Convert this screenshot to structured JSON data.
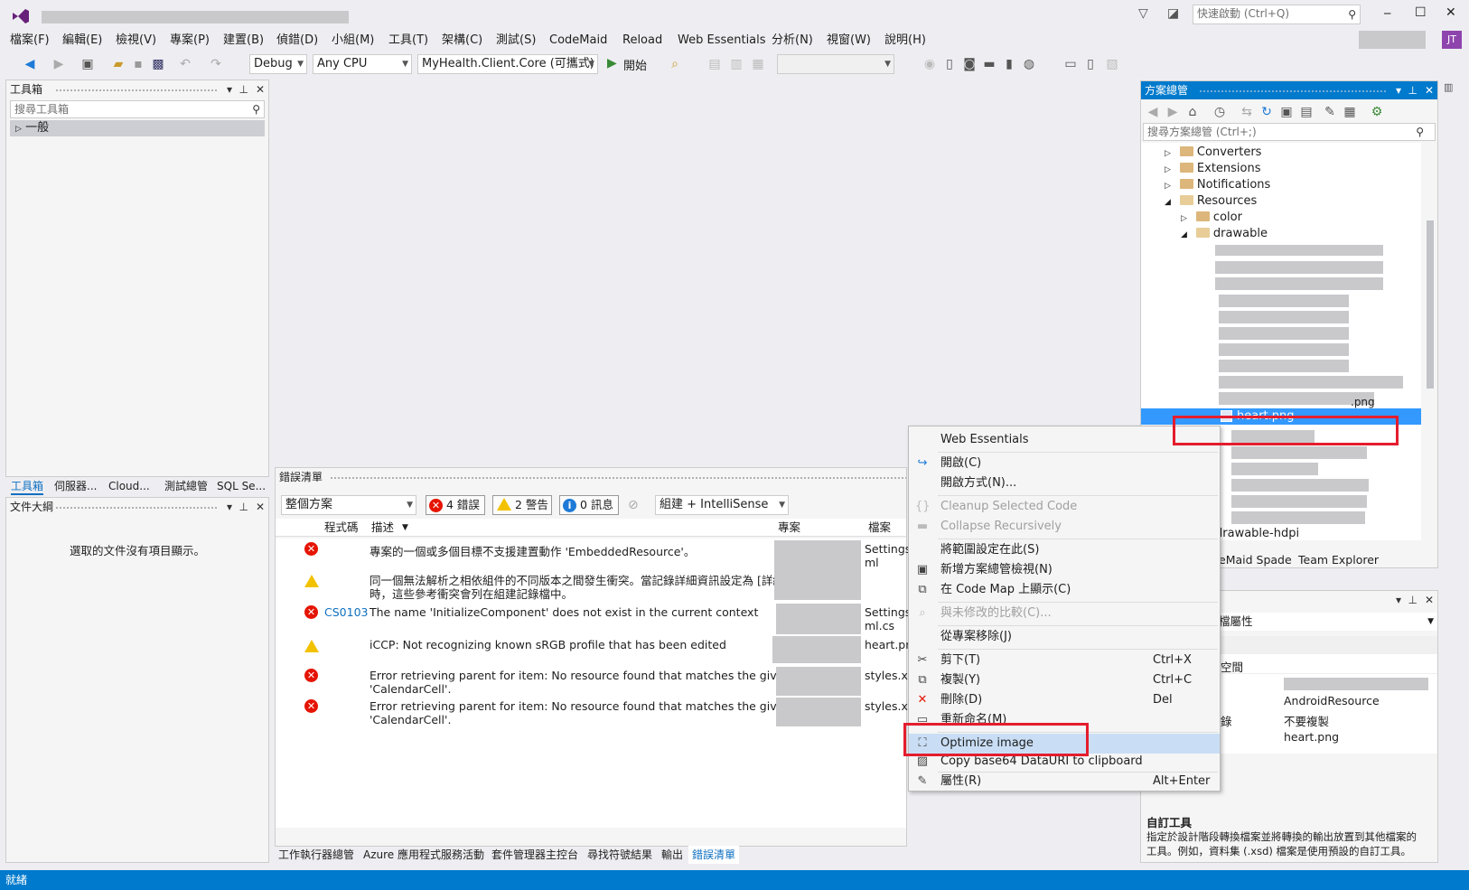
{
  "titlebar": {
    "quick_launch_placeholder": "快速啟動 (Ctrl+Q)",
    "user_initials": "JT",
    "minimize": "─",
    "maximize": "☐",
    "close": "✕"
  },
  "menu": [
    "檔案(F)",
    "編輯(E)",
    "檢視(V)",
    "專案(P)",
    "建置(B)",
    "偵錯(D)",
    "小組(M)",
    "工具(T)",
    "架構(C)",
    "測試(S)",
    "CodeMaid",
    "Reload",
    "Web Essentials",
    "分析(N)",
    "視窗(W)",
    "說明(H)"
  ],
  "toolbar": {
    "config": "Debug",
    "platform": "Any CPU",
    "startup_project": "MyHealth.Client.Core (可攜式)",
    "start_label": "開始"
  },
  "toolbox": {
    "title": "工具箱",
    "search_placeholder": "搜尋工具箱",
    "group": "一般",
    "tabs": [
      "工具箱",
      "伺服器...",
      "Cloud...",
      "測試總管",
      "SQL Se..."
    ]
  },
  "outline": {
    "title": "文件大綱",
    "empty_text": "選取的文件沒有項目顯示。"
  },
  "error_list": {
    "title": "錯誤清單",
    "scope": "整個方案",
    "errors_btn": "4 錯誤",
    "warnings_btn": "2 警告",
    "messages_btn": "0 訊息",
    "build_filter": "組建 + IntelliSense",
    "col_code": "程式碼",
    "col_desc": "描述",
    "col_project": "專案",
    "col_file": "檔案",
    "rows": [
      {
        "type": "error",
        "code": "",
        "desc1": "專案的一個或多個目標不支援建置動作 'EmbeddedResource'。",
        "desc2": "",
        "file1": "Settings",
        "file2": "ml"
      },
      {
        "type": "warning",
        "code": "",
        "desc1": "同一個無法解析之相依組件的不同版本之間發生衝突。當記錄詳細資訊設定為 [詳細]",
        "desc2": "時，這些參考衝突會列在組建記錄檔中。",
        "file1": "",
        "file2": ""
      },
      {
        "type": "error",
        "code": "CS0103",
        "desc1": "The name 'InitializeComponent' does not exist in the current context",
        "desc2": "",
        "file1": "Settings",
        "file2": "ml.cs"
      },
      {
        "type": "warning",
        "code": "",
        "desc1": "iCCP: Not recognizing known sRGB profile that has been edited",
        "desc2": "",
        "file1": "heart.pn",
        "file2": ""
      },
      {
        "type": "error",
        "code": "",
        "desc1": "Error retrieving parent for item: No resource found that matches the given name",
        "desc2": "'CalendarCell'.",
        "file1": "styles.xm",
        "file2": ""
      },
      {
        "type": "error",
        "code": "",
        "desc1": "Error retrieving parent for item: No resource found that matches the given name",
        "desc2": "'CalendarCell'.",
        "file1": "styles.xm",
        "file2": ""
      }
    ]
  },
  "bottom_tabs": [
    "工作執行器總管",
    "Azure 應用程式服務活動",
    "套件管理器主控台",
    "尋找符號結果",
    "輸出",
    "錯誤清單"
  ],
  "solution_explorer": {
    "title": "方案總管",
    "search_placeholder": "搜尋方案總管 (Ctrl+;)",
    "items": [
      {
        "label": "Converters"
      },
      {
        "label": "Extensions"
      },
      {
        "label": "Notifications"
      },
      {
        "label": "Resources"
      },
      {
        "label": "color"
      },
      {
        "label": "drawable"
      }
    ],
    "partial_png": ".png",
    "selected_file": "heart.png",
    "drawable_hdpi": "drawable-hdpi",
    "tabs": [
      "eMaid Spade",
      "Team Explorer"
    ]
  },
  "properties": {
    "header": "檔屬性",
    "row_namespace": "空間",
    "row_copy": "錄",
    "build_action": "AndroidResource",
    "copy_to_output": "不要複製",
    "file_name": "heart.png",
    "custom_tool_title": "自訂工具",
    "custom_tool_desc1": "指定於設計階段轉換檔案並將轉換的輸出放置到其他檔案的",
    "custom_tool_desc2": "工具。例如，資料集 (.xsd) 檔案是使用預設的自訂工具。"
  },
  "context_menu": {
    "web_essentials": "Web Essentials",
    "open": "開啟(C)",
    "open_with": "開啟方式(N)...",
    "cleanup": "Cleanup Selected Code",
    "collapse": "Collapse Recursively",
    "scope": "將範圍設定在此(S)",
    "new_view": "新增方案總管檢視(N)",
    "code_map": "在 Code Map 上顯示(C)",
    "compare": "與未修改的比較(C)...",
    "exclude": "從專案移除(J)",
    "cut": "剪下(T)",
    "cut_sc": "Ctrl+X",
    "copy": "複製(Y)",
    "copy_sc": "Ctrl+C",
    "delete": "刪除(D)",
    "delete_sc": "Del",
    "rename": "重新命名(M)",
    "optimize": "Optimize image",
    "base64": "Copy base64 DataURI to clipboard",
    "props": "屬性(R)",
    "props_sc": "Alt+Enter"
  },
  "status": "就緒",
  "colors": {
    "accent": "#007acc",
    "highlight_red": "#e41d2d",
    "selection": "#3399ff"
  }
}
